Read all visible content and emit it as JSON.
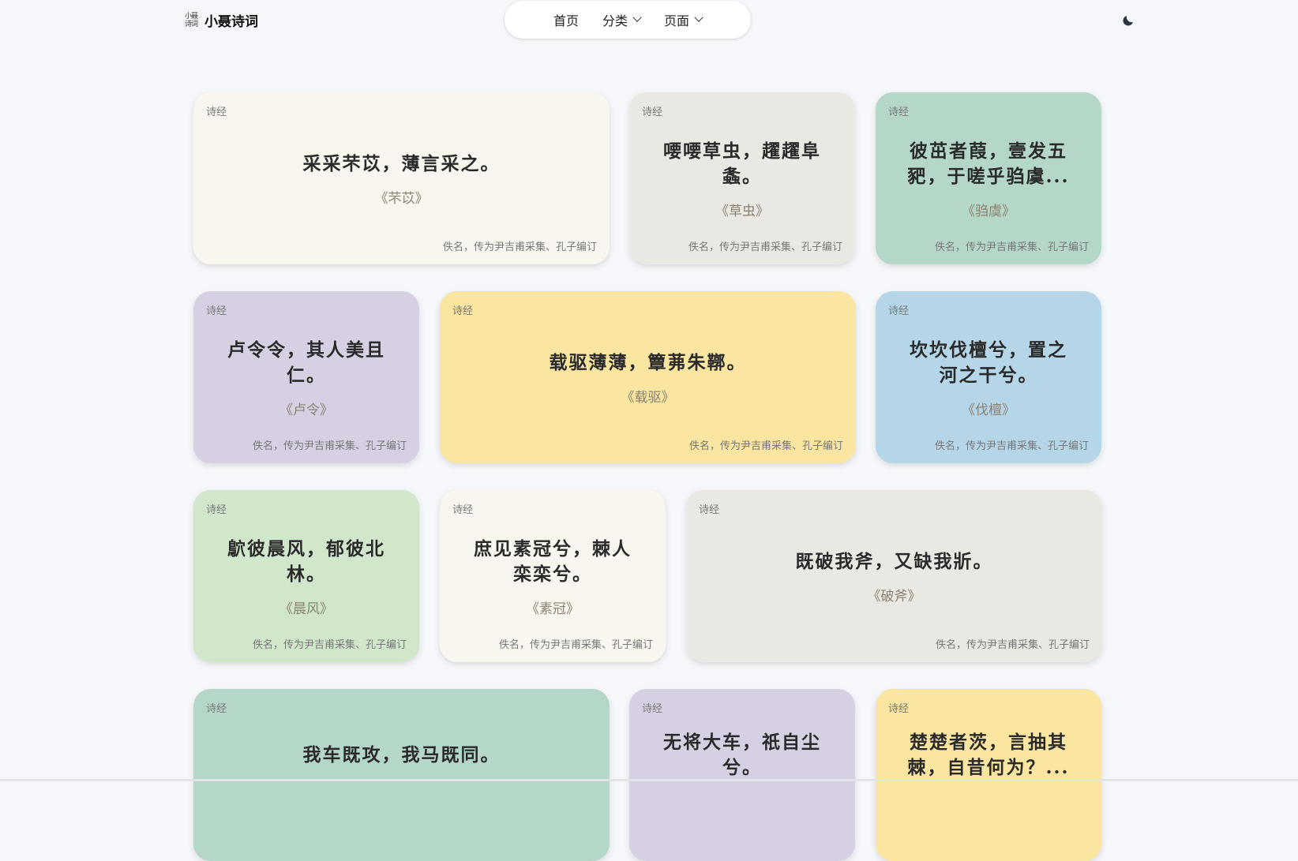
{
  "brand": {
    "logo_line1": "小聂",
    "logo_line2": "诗词",
    "title": "小聂诗词"
  },
  "nav": {
    "items": [
      {
        "label": "首页",
        "has_dropdown": false
      },
      {
        "label": "分类",
        "has_dropdown": true
      },
      {
        "label": "页面",
        "has_dropdown": true
      }
    ]
  },
  "theme_toggle": {
    "icon": "moon-icon"
  },
  "colors": {
    "cream": "#f8f6ee",
    "grey": "#e9e8e3",
    "green": "#b5d7c7",
    "lavender": "#d7cfe2",
    "yellow": "#fbe6a1",
    "blue": "#b5d6e8",
    "light_green": "#d0e7cb"
  },
  "cards": [
    {
      "category": "诗经",
      "line1": "采采芣苡，薄言采之。",
      "line2": "",
      "title": "《芣苡》",
      "author": "佚名，传为尹吉甫采集、孔子编订",
      "color": "#f8f6ee"
    },
    {
      "category": "诗经",
      "line1": "喓喓草虫，趯趯阜",
      "line2": "螽。",
      "title": "《草虫》",
      "author": "佚名，传为尹吉甫采集、孔子编订",
      "color": "#e9e8e3"
    },
    {
      "category": "诗经",
      "line1": "彼茁者葭，壹发五",
      "line2": "豝，于嗟乎驺虞...",
      "title": "《驺虞》",
      "author": "佚名，传为尹吉甫采集、孔子编订",
      "color": "#b5d7c7"
    },
    {
      "category": "诗经",
      "line1": "卢令令，其人美且",
      "line2": "仁。",
      "title": "《卢令》",
      "author": "佚名，传为尹吉甫采集、孔子编订",
      "color": "#d7cfe2"
    },
    {
      "category": "诗经",
      "line1": "载驱薄薄，簟茀朱鞹。",
      "line2": "",
      "title": "《载驱》",
      "author": "佚名，传为尹吉甫采集、孔子编订",
      "color": "#fbe6a1"
    },
    {
      "category": "诗经",
      "line1": "坎坎伐檀兮，置之",
      "line2": "河之干兮。",
      "title": "《伐檀》",
      "author": "佚名，传为尹吉甫采集、孔子编订",
      "color": "#b5d6e8"
    },
    {
      "category": "诗经",
      "line1": "鴥彼晨风，郁彼北",
      "line2": "林。",
      "title": "《晨风》",
      "author": "佚名，传为尹吉甫采集、孔子编订",
      "color": "#d0e7cb"
    },
    {
      "category": "诗经",
      "line1": "庶见素冠兮，棘人",
      "line2": "栾栾兮。",
      "title": "《素冠》",
      "author": "佚名，传为尹吉甫采集、孔子编订",
      "color": "#f8f6ee"
    },
    {
      "category": "诗经",
      "line1": "既破我斧，又缺我斨。",
      "line2": "",
      "title": "《破斧》",
      "author": "佚名，传为尹吉甫采集、孔子编订",
      "color": "#e9e8e3"
    },
    {
      "category": "诗经",
      "line1": "我车既攻，我马既同。",
      "line2": "",
      "title": "",
      "author": "",
      "color": "#b5d7c7"
    },
    {
      "category": "诗经",
      "line1": "无将大车，祇自尘",
      "line2": "兮。",
      "title": "",
      "author": "",
      "color": "#d7cfe2"
    },
    {
      "category": "诗经",
      "line1": "楚楚者茨，言抽其",
      "line2": "棘，自昔何为？...",
      "title": "",
      "author": "",
      "color": "#fbe6a1"
    }
  ]
}
